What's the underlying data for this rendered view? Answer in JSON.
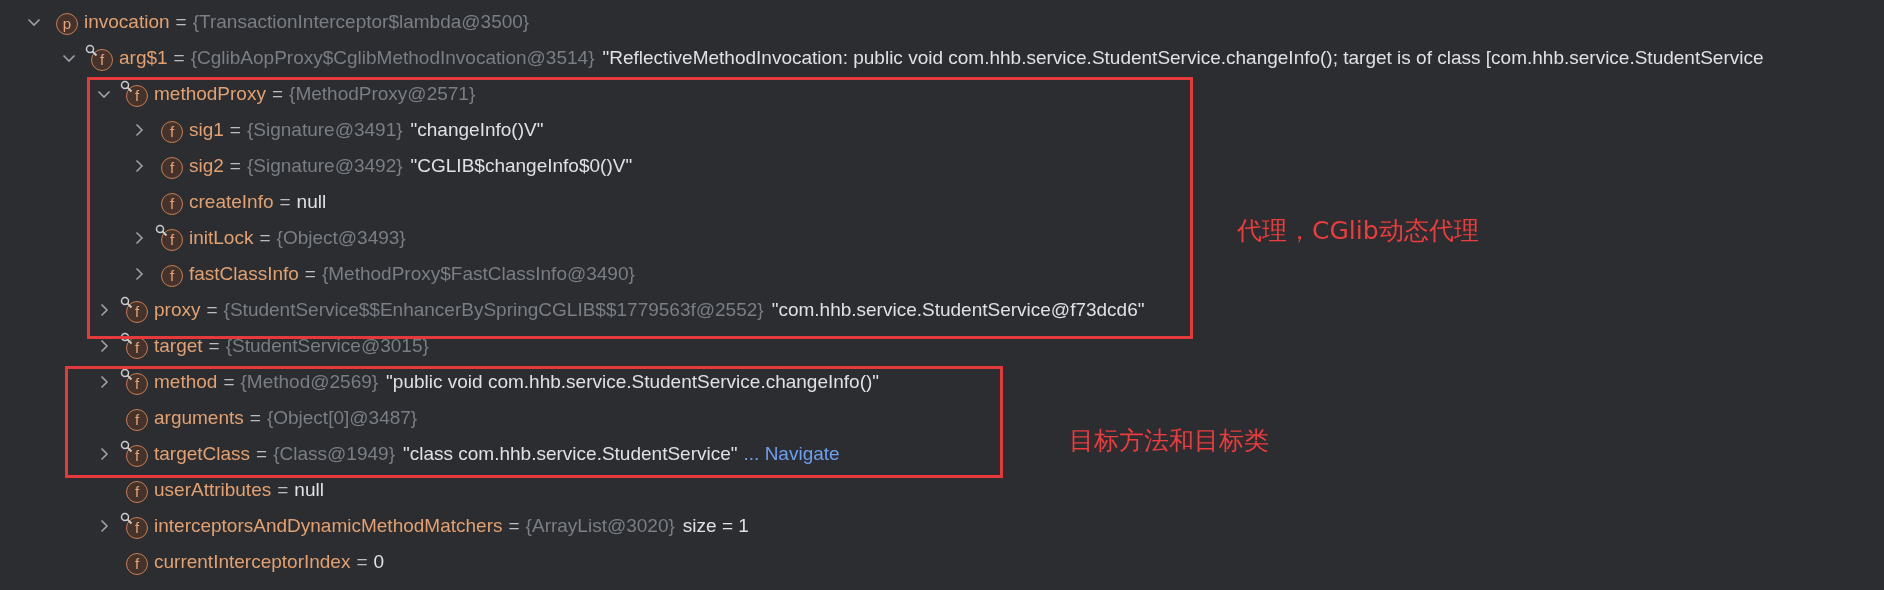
{
  "variables": [
    {
      "badge": "p",
      "restricted": false,
      "expanded": true,
      "name": "invocation",
      "operator": "=",
      "type": "{TransactionInterceptor$lambda@3500}",
      "children": [
        {
          "badge": "f",
          "restricted": true,
          "expanded": true,
          "name": "arg$1",
          "operator": "=",
          "type": "{CglibAopProxy$CglibMethodInvocation@3514}",
          "value": "\"ReflectiveMethodInvocation: public void com.hhb.service.StudentService.changeInfo(); target is of class [com.hhb.service.StudentService",
          "children": [
            {
              "badge": "f",
              "restricted": true,
              "expanded": true,
              "name": "methodProxy",
              "operator": "=",
              "type": "{MethodProxy@2571}",
              "children": [
                {
                  "badge": "f",
                  "restricted": false,
                  "expanded": false,
                  "name": "sig1",
                  "operator": "=",
                  "type": "{Signature@3491}",
                  "value": "\"changeInfo()V\""
                },
                {
                  "badge": "f",
                  "restricted": false,
                  "expanded": false,
                  "name": "sig2",
                  "operator": "=",
                  "type": "{Signature@3492}",
                  "value": "\"CGLIB$changeInfo$0()V\""
                },
                {
                  "badge": "f",
                  "restricted": false,
                  "name": "createInfo",
                  "operator": "=",
                  "value": "null"
                },
                {
                  "badge": "f",
                  "restricted": true,
                  "expanded": false,
                  "name": "initLock",
                  "operator": "=",
                  "type": "{Object@3493}"
                },
                {
                  "badge": "f",
                  "restricted": false,
                  "expanded": false,
                  "name": "fastClassInfo",
                  "operator": "=",
                  "type": "{MethodProxy$FastClassInfo@3490}"
                }
              ]
            },
            {
              "badge": "f",
              "restricted": true,
              "expanded": false,
              "name": "proxy",
              "operator": "=",
              "type": "{StudentService$$EnhancerBySpringCGLIB$$1779563f@2552}",
              "value": "\"com.hhb.service.StudentService@f73dcd6\""
            },
            {
              "badge": "f",
              "restricted": true,
              "expanded": false,
              "name": "target",
              "operator": "=",
              "type": "{StudentService@3015}"
            },
            {
              "badge": "f",
              "restricted": true,
              "expanded": false,
              "name": "method",
              "operator": "=",
              "type": "{Method@2569}",
              "value": "\"public void com.hhb.service.StudentService.changeInfo()\""
            },
            {
              "badge": "f",
              "restricted": false,
              "name": "arguments",
              "operator": "=",
              "type": "{Object[0]@3487}"
            },
            {
              "badge": "f",
              "restricted": true,
              "expanded": false,
              "name": "targetClass",
              "operator": "=",
              "type": "{Class@1949}",
              "value": "\"class com.hhb.service.StudentService\"",
              "link": "... Navigate"
            },
            {
              "badge": "f",
              "restricted": false,
              "name": "userAttributes",
              "operator": "=",
              "value": "null"
            },
            {
              "badge": "f",
              "restricted": true,
              "expanded": false,
              "name": "interceptorsAndDynamicMethodMatchers",
              "operator": "=",
              "type": "{ArrayList@3020}",
              "value": "size = 1"
            },
            {
              "badge": "f",
              "restricted": false,
              "name": "currentInterceptorIndex",
              "operator": "=",
              "value": "0"
            }
          ]
        }
      ]
    }
  ],
  "annotations": [
    {
      "text": "代理，CGlib动态代理"
    },
    {
      "text": "目标方法和目标类"
    }
  ]
}
